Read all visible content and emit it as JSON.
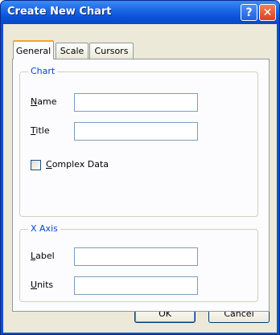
{
  "window": {
    "title": "Create New Chart",
    "help_glyph": "?",
    "close_glyph": "✕"
  },
  "tabs": [
    {
      "label": "General",
      "active": true
    },
    {
      "label": "Scale",
      "active": false
    },
    {
      "label": "Cursors",
      "active": false
    }
  ],
  "chart_group": {
    "title": "Chart",
    "name_label": "Name",
    "name_value": "",
    "title_label": "Title",
    "title_value": "",
    "complex_label": "Complex Data",
    "complex_checked": false
  },
  "xaxis_group": {
    "title": "X Axis",
    "label_label": "Label",
    "label_value": "",
    "units_label": "Units",
    "units_value": ""
  },
  "buttons": {
    "ok": "OK",
    "cancel": "Cancel"
  }
}
